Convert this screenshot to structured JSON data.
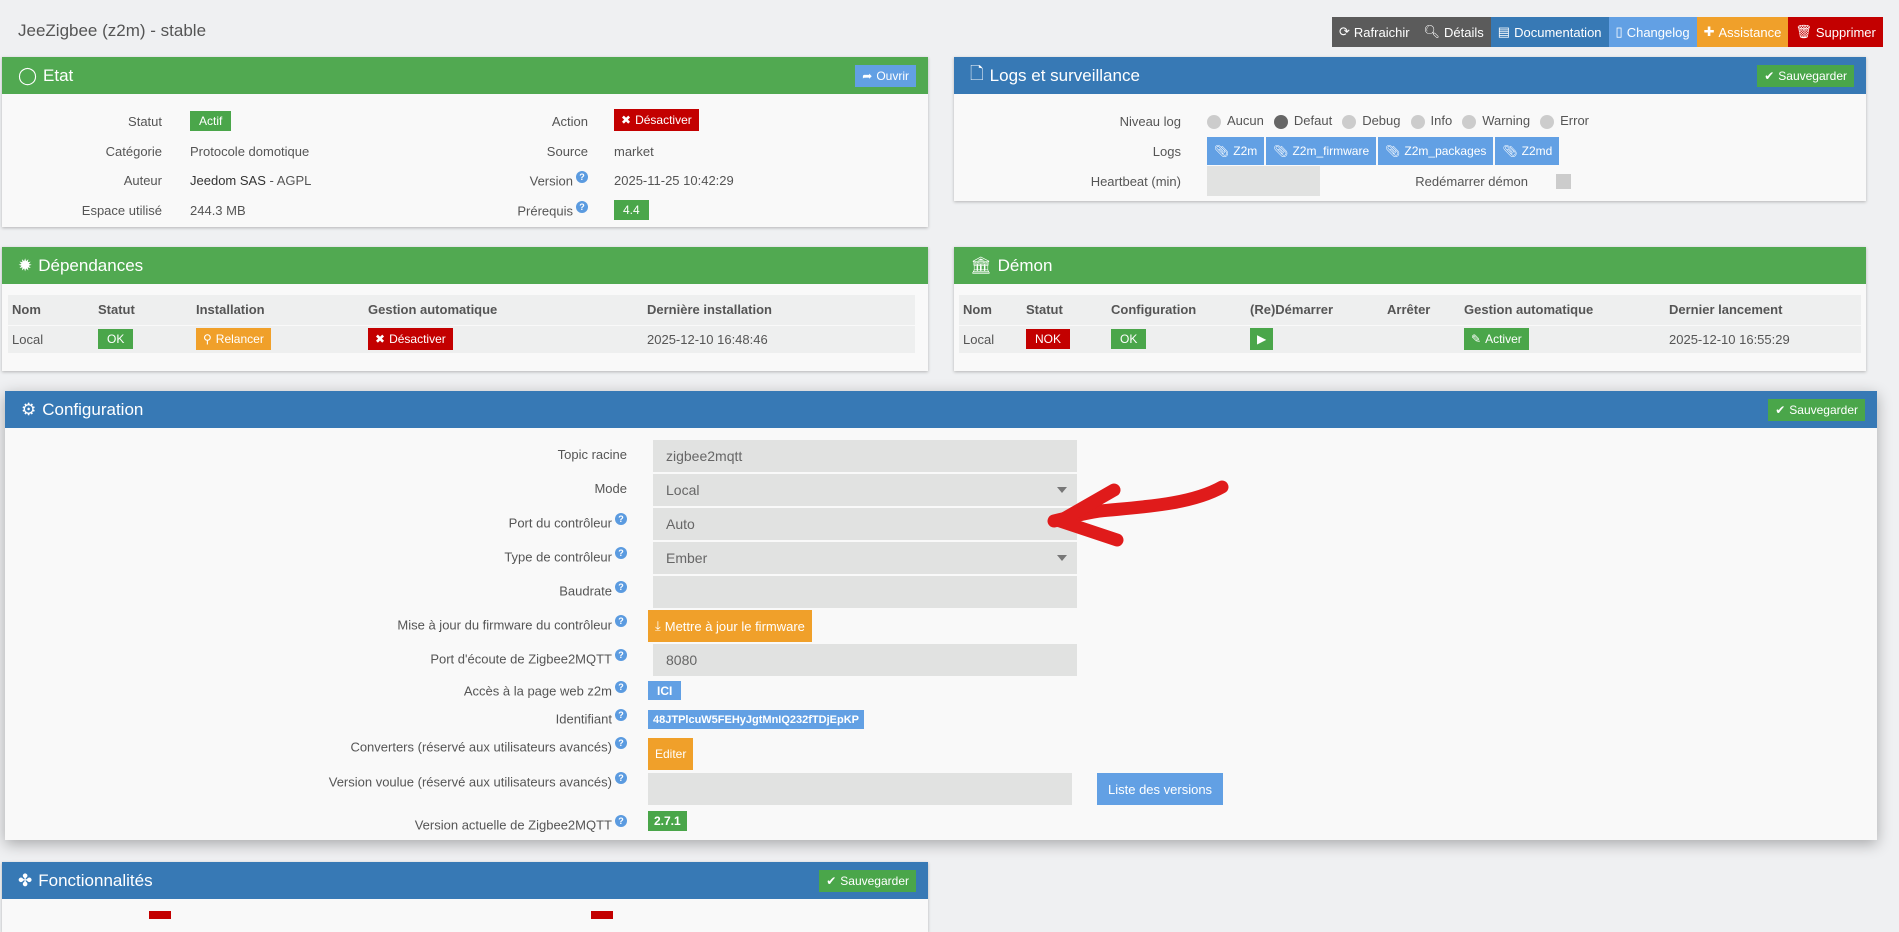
{
  "header": {
    "title": "JeeZigbee (z2m) - stable"
  },
  "toolbar": {
    "refresh": "Rafraichir",
    "details": "Détails",
    "documentation": "Documentation",
    "changelog": "Changelog",
    "assistance": "Assistance",
    "delete": "Supprimer"
  },
  "etat": {
    "title": "Etat",
    "open": "Ouvrir",
    "statut_label": "Statut",
    "statut": "Actif",
    "categorie_label": "Catégorie",
    "categorie": "Protocole domotique",
    "auteur_label": "Auteur",
    "auteur": "Jeedom SAS",
    "licence": "- AGPL",
    "espace_label": "Espace utilisé",
    "espace": "244.3 MB",
    "action_label": "Action",
    "action": "Désactiver",
    "source_label": "Source",
    "source": "market",
    "version_label": "Version",
    "version": "2025-11-25 10:42:29",
    "prerequis_label": "Prérequis",
    "prerequis": "4.4"
  },
  "logs": {
    "title": "Logs et surveillance",
    "save": "Sauvegarder",
    "niveau_label": "Niveau log",
    "levels": [
      "Aucun",
      "Defaut",
      "Debug",
      "Info",
      "Warning",
      "Error"
    ],
    "selected_level": "Defaut",
    "logs_label": "Logs",
    "log_buttons": [
      "Z2m",
      "Z2m_firmware",
      "Z2m_packages",
      "Z2md"
    ],
    "heartbeat_label": "Heartbeat (min)",
    "heartbeat": "",
    "restart_label": "Redémarrer démon"
  },
  "dependances": {
    "title": "Dépendances",
    "headers": [
      "Nom",
      "Statut",
      "Installation",
      "Gestion automatique",
      "Dernière installation"
    ],
    "row": {
      "nom": "Local",
      "statut": "OK",
      "installation": "Relancer",
      "gestion": "Désactiver",
      "derniere": "2025-12-10 16:48:46"
    }
  },
  "demon": {
    "title": "Démon",
    "headers": [
      "Nom",
      "Statut",
      "Configuration",
      "(Re)Démarrer",
      "Arrêter",
      "Gestion automatique",
      "Dernier lancement"
    ],
    "row": {
      "nom": "Local",
      "statut": "NOK",
      "configuration": "OK",
      "gestion": "Activer",
      "dernier": "2025-12-10 16:55:29"
    }
  },
  "configuration": {
    "title": "Configuration",
    "save": "Sauvegarder",
    "topic_label": "Topic racine",
    "topic": "zigbee2mqtt",
    "mode_label": "Mode",
    "mode": "Local",
    "port_label": "Port du contrôleur",
    "port": "Auto",
    "type_label": "Type de contrôleur",
    "type": "Ember",
    "baudrate_label": "Baudrate",
    "baudrate": "",
    "firmware_label": "Mise à jour du firmware du contrôleur",
    "firmware_button": "Mettre à jour le firmware",
    "listen_label": "Port d'écoute de Zigbee2MQTT",
    "listen": "8080",
    "web_label": "Accès à la page web z2m",
    "web_button": "ICI",
    "id_label": "Identifiant",
    "id": "48JTPlcuW5FEHyJgtMnIQ232fTDjEpKP",
    "converters_label": "Converters (réservé aux utilisateurs avancés)",
    "converters_button": "Editer",
    "wanted_label": "Version voulue (réservé aux utilisateurs avancés)",
    "wanted": "",
    "versions_button": "Liste des versions",
    "current_label": "Version actuelle de Zigbee2MQTT",
    "current": "2.7.1"
  },
  "fonctionnalites": {
    "title": "Fonctionnalités",
    "save": "Sauvegarder"
  },
  "colors": {
    "green": "#51a951",
    "blue": "#3779b5",
    "red": "#c30000",
    "orange": "#f0a02a",
    "light_blue": "#62a0e4",
    "annotation": "#e01b1b"
  }
}
